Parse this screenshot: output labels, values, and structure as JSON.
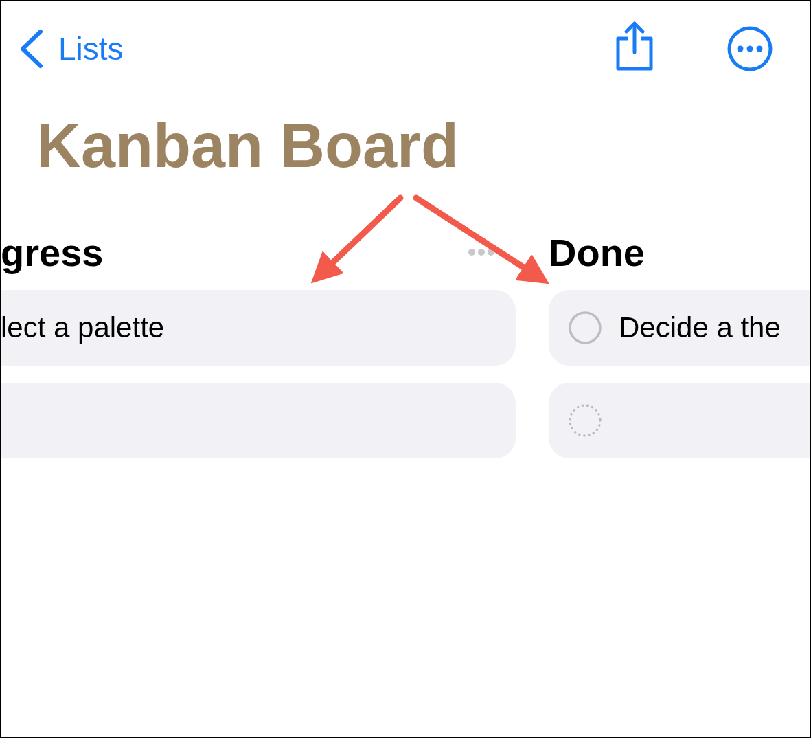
{
  "nav": {
    "back_label": "Lists"
  },
  "title": "Kanban Board",
  "columns": [
    {
      "title": "gress",
      "has_menu": true,
      "cards": [
        {
          "kind": "text",
          "text": "lect a palette"
        },
        {
          "kind": "blank"
        }
      ]
    },
    {
      "title": "Done",
      "has_menu": false,
      "cards": [
        {
          "kind": "task",
          "text": "Decide a the"
        },
        {
          "kind": "new"
        }
      ]
    }
  ]
}
